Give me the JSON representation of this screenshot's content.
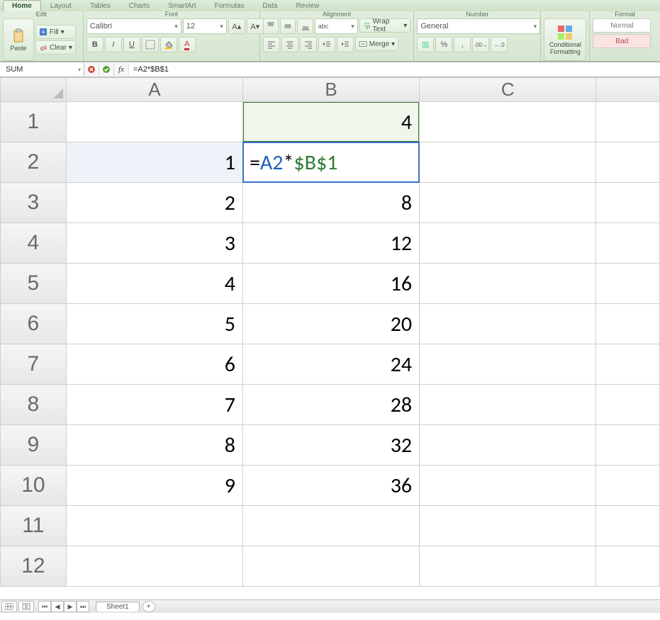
{
  "tabs": {
    "home": "Home",
    "layout": "Layout",
    "tables": "Tables",
    "charts": "Charts",
    "smartart": "SmartArt",
    "formulas": "Formulas",
    "data": "Data",
    "review": "Review"
  },
  "ribbon": {
    "edit": {
      "title": "Edit",
      "paste": "Paste",
      "fill": "Fill",
      "clear": "Clear"
    },
    "font": {
      "title": "Font",
      "name": "Calibri",
      "size": "12"
    },
    "alignment": {
      "title": "Alignment",
      "abc": "abc",
      "wrap": "Wrap Text",
      "merge": "Merge"
    },
    "number": {
      "title": "Number",
      "format": "General"
    },
    "condfmt": {
      "label1": "Conditional",
      "label2": "Formatting"
    },
    "format": {
      "title": "Format",
      "normal": "Normal",
      "bad": "Bad"
    }
  },
  "formula_bar": {
    "name": "SUM",
    "fx": "fx",
    "formula": "=A2*$B$1"
  },
  "columns": [
    "A",
    "B",
    "C"
  ],
  "rows": [
    "1",
    "2",
    "3",
    "4",
    "5",
    "6",
    "7",
    "8",
    "9",
    "10",
    "11",
    "12"
  ],
  "cells": {
    "B1": "4",
    "A2": "1",
    "A3": "2",
    "B3": "8",
    "A4": "3",
    "B4": "12",
    "A5": "4",
    "B5": "16",
    "A6": "5",
    "B6": "20",
    "A7": "6",
    "B7": "24",
    "A8": "7",
    "B8": "28",
    "A9": "8",
    "B9": "32",
    "A10": "9",
    "B10": "36"
  },
  "edit": {
    "eq": "=",
    "ref": "A2",
    "op": "*",
    "abs": "$B$1"
  },
  "status": {
    "sheet": "Sheet1"
  }
}
